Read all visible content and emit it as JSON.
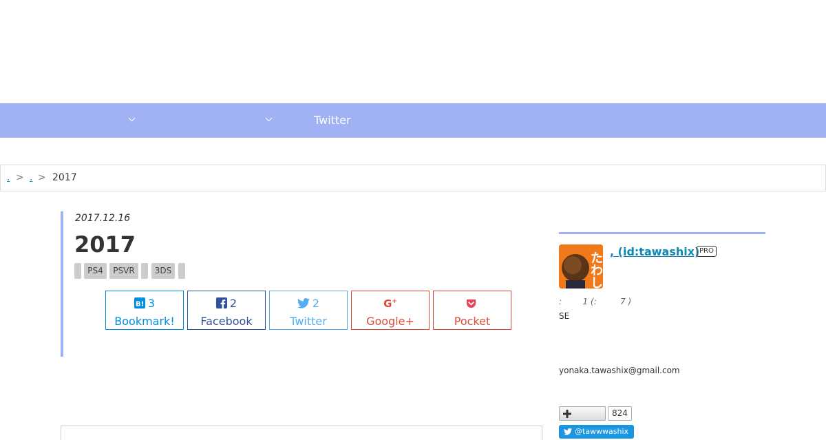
{
  "nav": {
    "twitter_label": "Twitter"
  },
  "breadcrumb": {
    "link1": ".",
    "link2": ".",
    "sep": ">",
    "current": "2017"
  },
  "article": {
    "date": "2017.12.16",
    "title": "2017",
    "tags": [
      "",
      "PS4",
      "PSVR",
      "",
      "3DS",
      ""
    ]
  },
  "share": {
    "hatena": {
      "count": "3",
      "label": "Bookmark!",
      "color": "#008fde"
    },
    "facebook": {
      "count": "2",
      "label": "Facebook",
      "color": "#305097"
    },
    "twitter": {
      "count": "2",
      "label": "Twitter",
      "color": "#55acee"
    },
    "google": {
      "count": "",
      "label": "Google+",
      "color": "#db4a39"
    },
    "pocket": {
      "count": "",
      "label": "Pocket",
      "color": "#ee4256"
    }
  },
  "sidebar": {
    "profile": {
      "name": ", (id:tawashix)",
      "badge": "PRO",
      "avatar_text": "たわし",
      "meta": ":        1 (:         7 )",
      "bio": "SE",
      "email": "yonaka.tawashix@gmail.com",
      "follow_icon": "plus-icon",
      "follower_count": "824",
      "twitter_handle": "@tawwwashix"
    }
  }
}
